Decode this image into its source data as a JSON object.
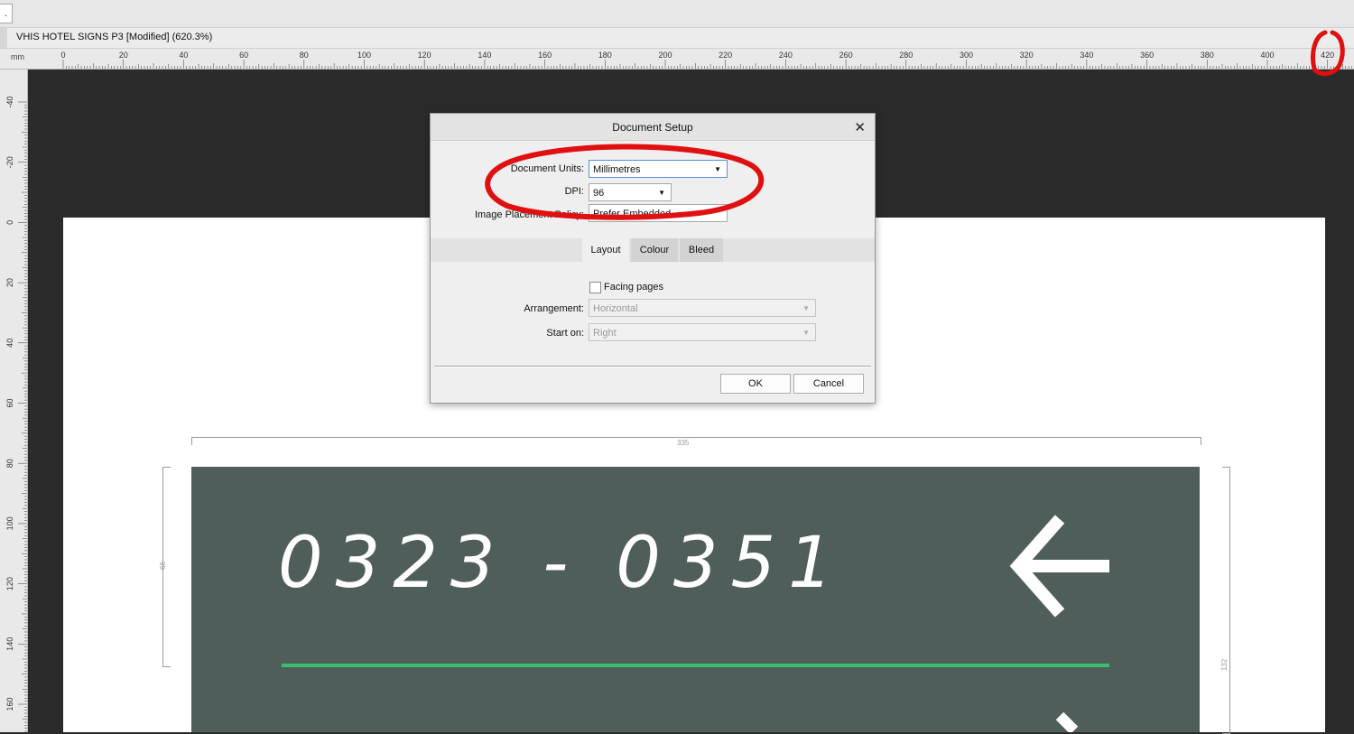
{
  "app": {
    "top_strip_text": ".",
    "document_title": "VHIS HOTEL SIGNS P3 [Modified] (620.3%)"
  },
  "rulers": {
    "unit": "mm",
    "horizontal_labels": [
      "0",
      "20",
      "40",
      "60",
      "80",
      "100",
      "120",
      "140",
      "160",
      "180",
      "200",
      "220",
      "240",
      "260",
      "280",
      "300",
      "320",
      "340",
      "360",
      "380",
      "400",
      "420"
    ],
    "vertical_labels": [
      "-40",
      "-20",
      "0",
      "20",
      "40",
      "60",
      "80",
      "100",
      "120",
      "140",
      "160"
    ]
  },
  "canvas": {
    "sign_number": "0323 - 0351",
    "dimension_top": "335",
    "dimension_left": "66",
    "dimension_right": "132",
    "sign_color": "#505e5b",
    "line_color": "#3bbf6b"
  },
  "dialog": {
    "title": "Document Setup",
    "close_icon": "close-icon",
    "document_units_label": "Document Units:",
    "document_units_value": "Millimetres",
    "dpi_label": "DPI:",
    "dpi_value": "96",
    "image_placement_label": "Image Placement Policy:",
    "image_placement_value": "Prefer Embedded",
    "tabs": [
      "Layout",
      "Colour",
      "Bleed"
    ],
    "active_tab": "Layout",
    "facing_pages_label": "Facing pages",
    "facing_pages_checked": false,
    "arrangement_label": "Arrangement:",
    "arrangement_value": "Horizontal",
    "start_on_label": "Start on:",
    "start_on_value": "Right",
    "ok_label": "OK",
    "cancel_label": "Cancel"
  },
  "annotations": {
    "color": "#e01010"
  }
}
